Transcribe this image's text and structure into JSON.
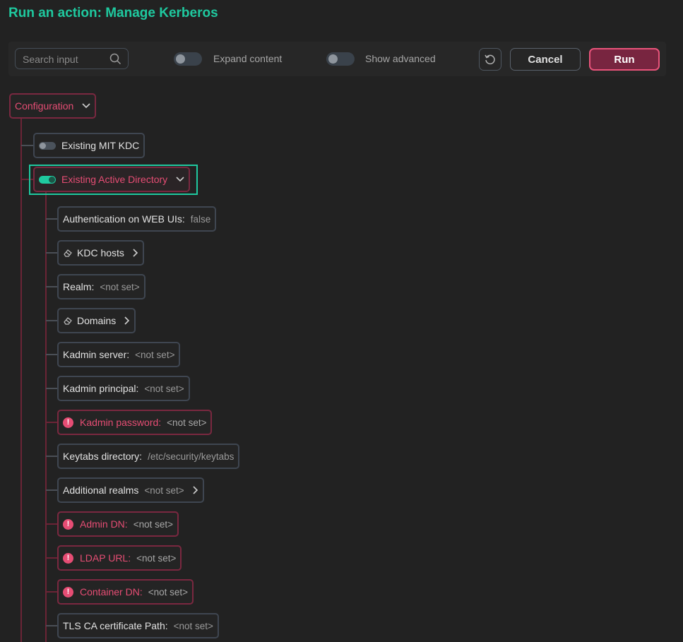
{
  "title": "Run an action: Manage Kerberos",
  "toolbar": {
    "search_placeholder": "Search input",
    "expand_label": "Expand content",
    "advanced_label": "Show advanced",
    "cancel_label": "Cancel",
    "run_label": "Run"
  },
  "tree": {
    "root_label": "Configuration",
    "mit_label": "Existing MIT KDC",
    "ad_label": "Existing Active Directory",
    "fields": [
      {
        "label": "Authentication on WEB UIs:",
        "value": "false"
      },
      {
        "label": "KDC hosts",
        "value": ""
      },
      {
        "label": "Realm:",
        "value": "<not set>"
      },
      {
        "label": "Domains",
        "value": ""
      },
      {
        "label": "Kadmin server:",
        "value": "<not set>"
      },
      {
        "label": "Kadmin principal:",
        "value": "<not set>"
      },
      {
        "label": "Kadmin password:",
        "value": "<not set>"
      },
      {
        "label": "Keytabs directory:",
        "value": "/etc/security/keytabs"
      },
      {
        "label": "Additional realms",
        "value": "<not set>"
      },
      {
        "label": "Admin DN:",
        "value": "<not set>"
      },
      {
        "label": "LDAP URL:",
        "value": "<not set>"
      },
      {
        "label": "Container DN:",
        "value": "<not set>"
      },
      {
        "label": "TLS CA certificate Path:",
        "value": "<not set>"
      }
    ]
  }
}
